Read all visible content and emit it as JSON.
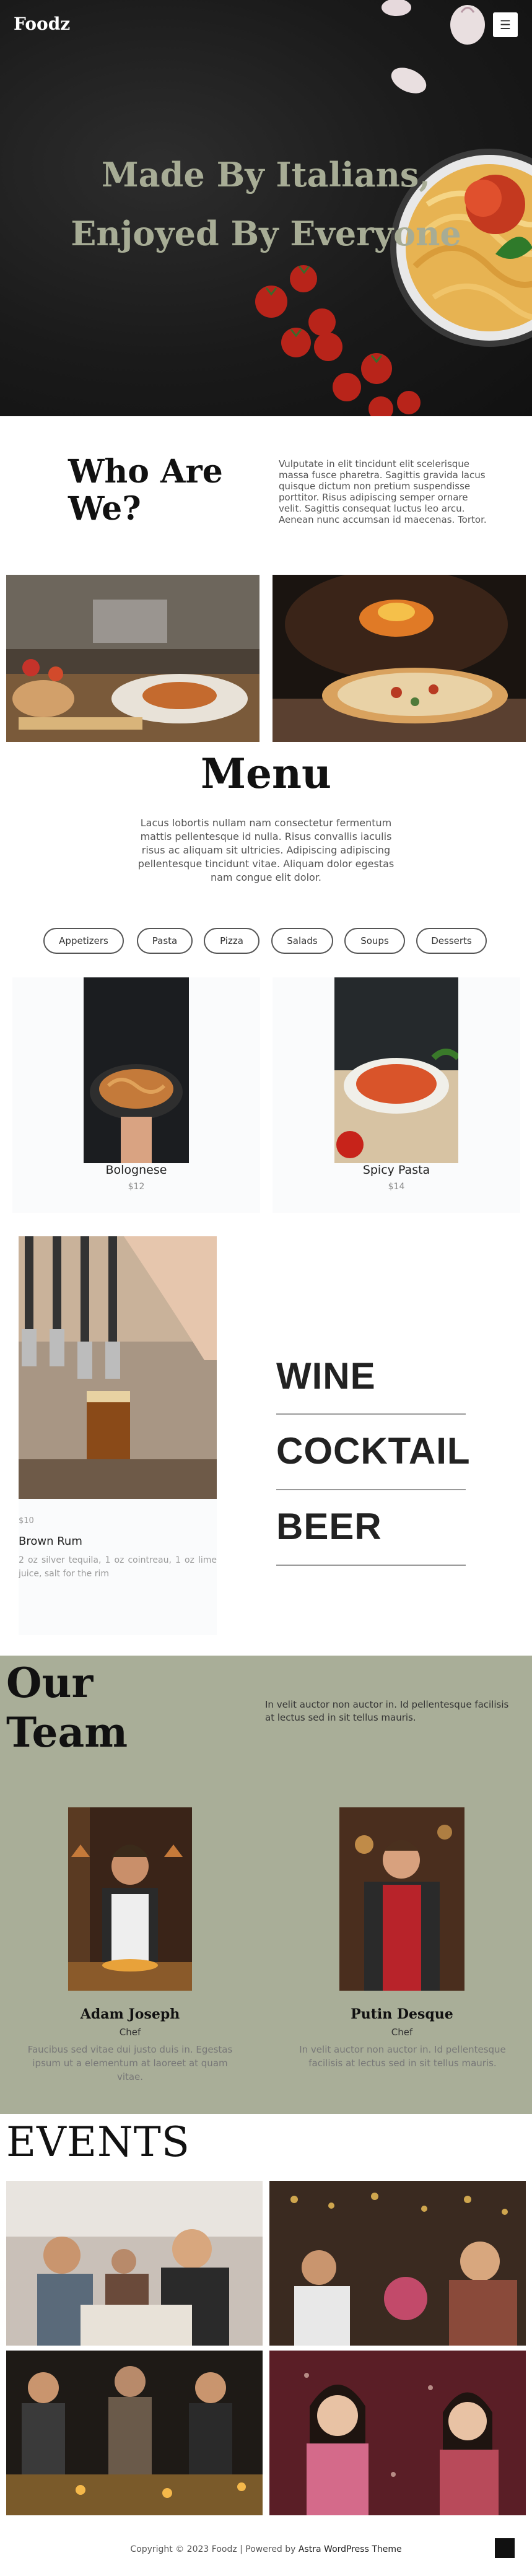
{
  "header": {
    "brand": "Foodz",
    "menu_icon": "hamburger-icon"
  },
  "hero": {
    "line1": "Made By Italians,",
    "line2": "Enjoyed By Everyone"
  },
  "about": {
    "title_line1": "Who Are",
    "title_line2": "We?",
    "text": "Vulputate in elit tincidunt elit scelerisque massa fusce pharetra. Sagittis gravida lacus quisque dictum non pretium suspendisse porttitor. Risus adipiscing semper ornare velit. Sagittis consequat luctus leo arcu. Aenean nunc accumsan id maecenas. Tortor."
  },
  "menu": {
    "title": "Menu",
    "text": "Lacus lobortis nullam nam consectetur fermentum mattis pellentesque id nulla. Risus convallis iaculis risus ac aliquam sit ultricies. Adipiscing adipiscing pellentesque tincidunt vitae. Aliquam dolor egestas nam congue elit dolor.",
    "categories": [
      "Appetizers",
      "Pasta",
      "Pizza",
      "Salads",
      "Soups",
      "Desserts"
    ],
    "items": [
      {
        "name": "Bolognese",
        "price": "$12"
      },
      {
        "name": "Spicy Pasta",
        "price": "$14"
      }
    ]
  },
  "drinks": {
    "item": {
      "price": "$10",
      "name": "Brown Rum",
      "desc": "2 oz silver tequila, 1 oz cointreau, 1 oz lime juice, salt for the rim"
    },
    "categories": [
      "WINE",
      "COCKTAIL",
      "BEER"
    ]
  },
  "team": {
    "title_line1": "Our",
    "title_line2": "Team",
    "text": "In velit auctor non auctor in. Id pellentesque facilisis at lectus sed in sit tellus mauris.",
    "members": [
      {
        "name": "Adam Joseph",
        "role": "Chef",
        "bio": "Faucibus sed vitae dui justo duis in. Egestas ipsum ut a elementum at laoreet at quam vitae."
      },
      {
        "name": "Putin Desque",
        "role": "Chef",
        "bio": "In velit auctor non auctor in. Id pellentesque facilisis at lectus sed in sit tellus mauris."
      }
    ]
  },
  "events": {
    "title": "EVENTS"
  },
  "footer": {
    "prefix": "Copyright © 2023 Foodz | Powered by ",
    "link": "Astra WordPress Theme"
  },
  "colors": {
    "sage": "#a9ae98",
    "hero_text": "#a7ac95",
    "dark": "#1c1c1c"
  }
}
